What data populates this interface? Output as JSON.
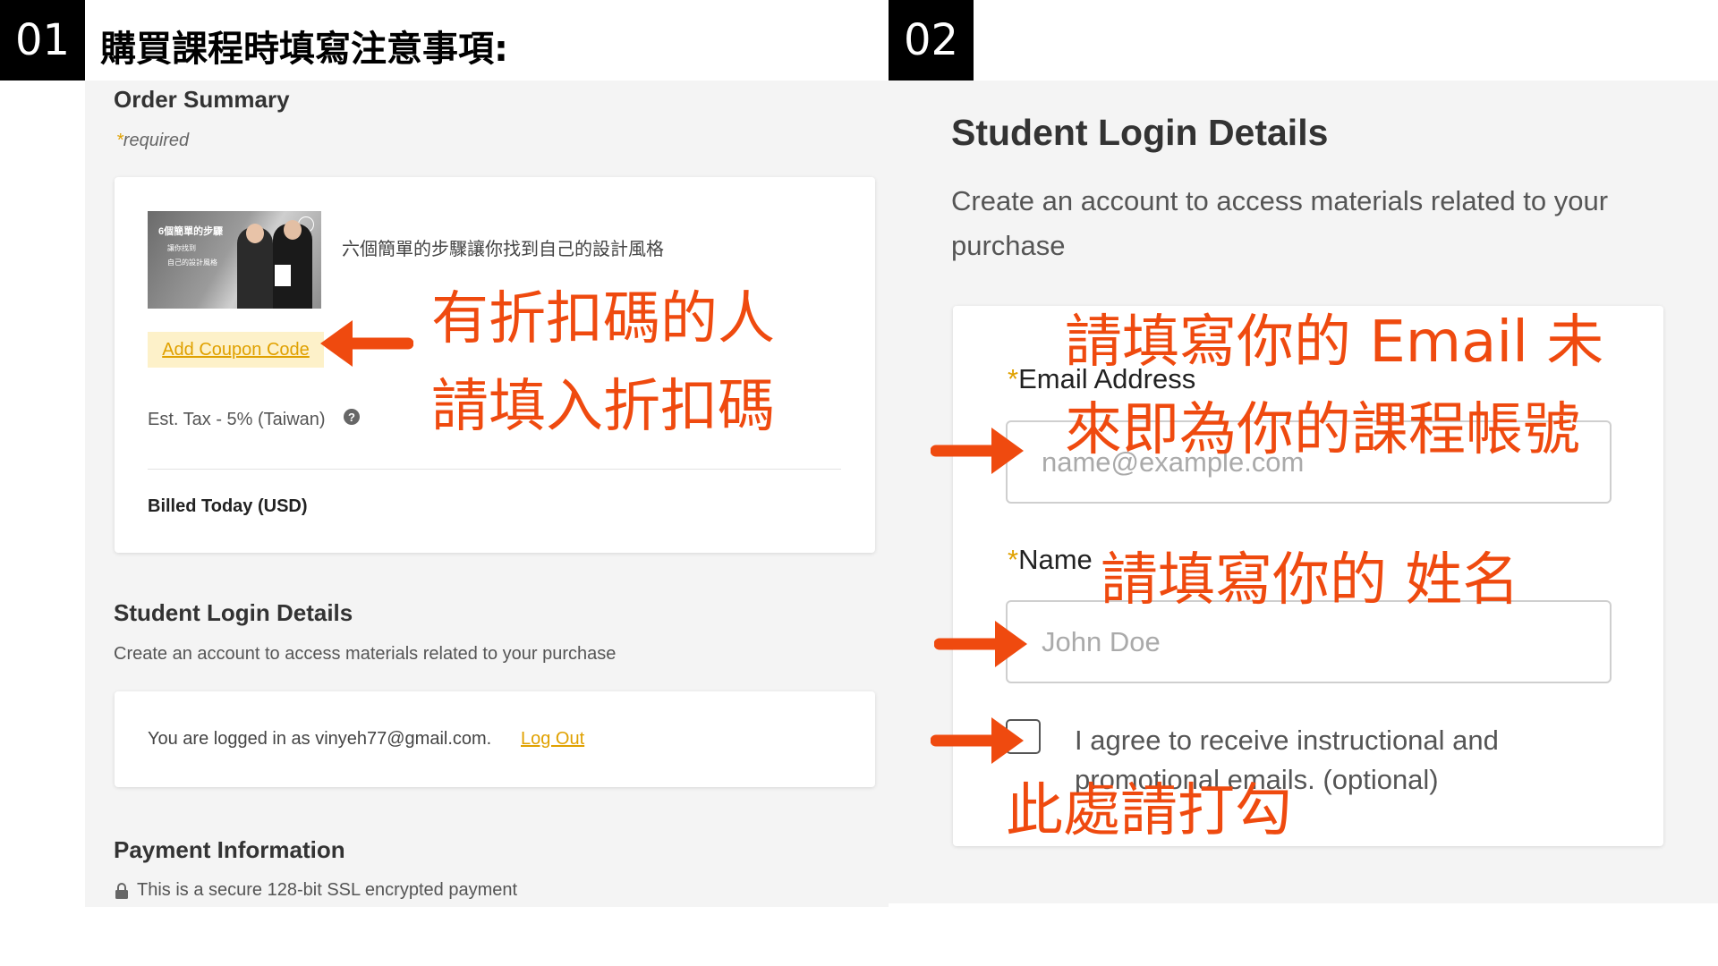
{
  "header": {
    "step1": "01",
    "step2": "02",
    "title": "購買課程時填寫注意事項:"
  },
  "order_summary": {
    "title": "Order Summary",
    "required_star": "*",
    "required_text": "required",
    "thumbnail": {
      "title": "6個簡單的步驟",
      "line1": "讓你找到",
      "line2": "自己的設計風格"
    },
    "course_name": "六個簡單的步驟讓你找到自己的設計風格",
    "coupon_button": "Add Coupon Code",
    "tax_label": "Est. Tax - 5% (Taiwan)",
    "help_icon": "?",
    "billed_today": "Billed Today (USD)"
  },
  "student_login_small": {
    "title": "Student Login Details",
    "subtitle": "Create an account to access materials related to your purchase",
    "logged_in_text": "You are logged in as vinyeh77@gmail.com.",
    "logout_link": "Log Out"
  },
  "payment": {
    "title": "Payment Information",
    "secure_text": "This is a secure 128-bit SSL encrypted payment"
  },
  "student_login_form": {
    "title": "Student Login Details",
    "subtitle": "Create an account to access materials related to your purchase",
    "email_star": "*",
    "email_label": "Email Address",
    "email_placeholder": "name@example.com",
    "name_star": "*",
    "name_label": "Name",
    "name_placeholder": "John Doe",
    "agree_text": "I agree to receive instructional and promotional emails. (optional)"
  },
  "annotations": {
    "coupon_line1": "有折扣碼的人",
    "coupon_line2": "請填入折扣碼",
    "email_line1": "請填寫你的 Email 未",
    "email_line2": "來即為你的課程帳號",
    "name": "請填寫你的 姓名",
    "checkbox": "此處請打勾"
  },
  "colors": {
    "annotation": "#ef4a0f",
    "accent": "#e0a100",
    "tag_background": "#000000"
  },
  "icons": {
    "arrow": "arrow-left-icon",
    "lock": "lock-icon",
    "help": "help-circle-icon"
  }
}
